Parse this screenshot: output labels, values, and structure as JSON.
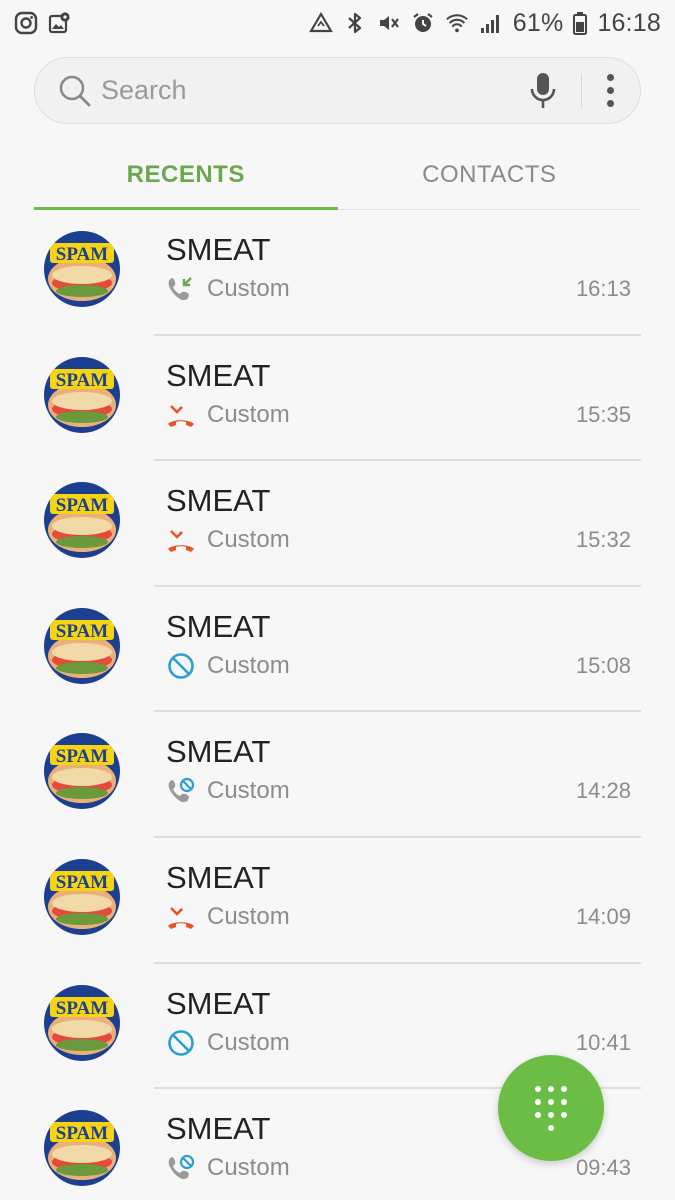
{
  "status_bar": {
    "left_icons": [
      "instagram-icon",
      "gallery-location-icon"
    ],
    "right_icons": [
      "data-saver-icon",
      "bluetooth-icon",
      "vibrate-mute-icon",
      "alarm-icon",
      "wifi-icon",
      "signal-icon",
      "battery-icon"
    ],
    "battery": "61%",
    "time": "16:18"
  },
  "search": {
    "placeholder": "Search"
  },
  "tabs": [
    {
      "label": "RECENTS",
      "active": true
    },
    {
      "label": "CONTACTS",
      "active": false
    }
  ],
  "calls": [
    {
      "name": "SMEAT",
      "type": "incoming",
      "label": "Custom",
      "time": "16:13"
    },
    {
      "name": "SMEAT",
      "type": "missed",
      "label": "Custom",
      "time": "15:35"
    },
    {
      "name": "SMEAT",
      "type": "missed",
      "label": "Custom",
      "time": "15:32"
    },
    {
      "name": "SMEAT",
      "type": "blocked",
      "label": "Custom",
      "time": "15:08"
    },
    {
      "name": "SMEAT",
      "type": "rejected",
      "label": "Custom",
      "time": "14:28"
    },
    {
      "name": "SMEAT",
      "type": "missed",
      "label": "Custom",
      "time": "14:09"
    },
    {
      "name": "SMEAT",
      "type": "blocked",
      "label": "Custom",
      "time": "10:41"
    },
    {
      "name": "SMEAT",
      "type": "rejected",
      "label": "Custom",
      "time": "09:43"
    }
  ],
  "avatar_logo_text": "SPAM",
  "colors": {
    "accent": "#6cbd45",
    "missed": "#e8542a",
    "incoming": "#6aa84f",
    "blocked": "#2a9fd0"
  }
}
